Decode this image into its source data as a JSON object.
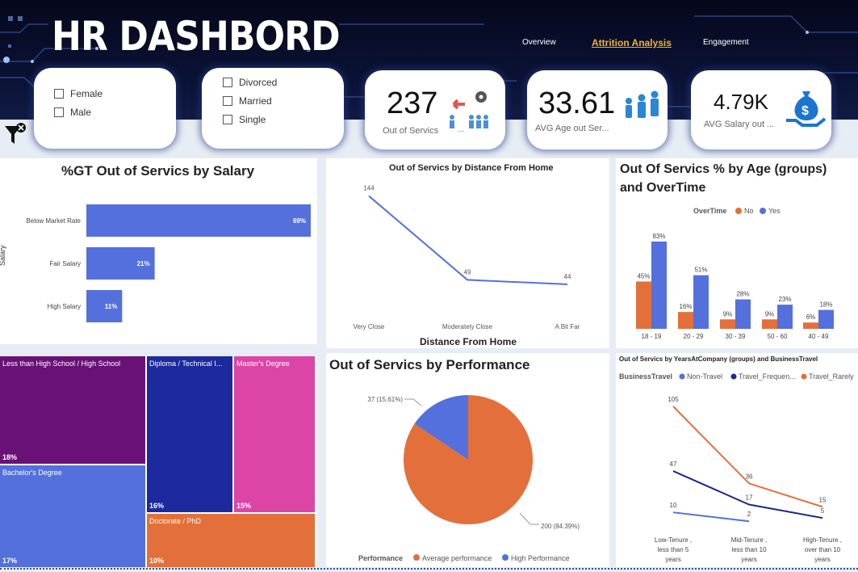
{
  "header": {
    "title": "HR DASHBORD",
    "nav": [
      "Overview",
      "Attrition Analysis",
      "Engagement"
    ],
    "active_nav": "Attrition Analysis"
  },
  "slicers": {
    "gender": [
      "Female",
      "Male"
    ],
    "marital": [
      "Divorced",
      "Married",
      "Single"
    ]
  },
  "kpis": [
    {
      "value": "237",
      "label": "Out of Servics",
      "icon": "people-out-icon"
    },
    {
      "value": "33.61",
      "label": "AVG Age out Ser...",
      "icon": "people-group-icon"
    },
    {
      "value": "4.79K",
      "label": "AVG Salary out ...",
      "icon": "money-bag-icon"
    }
  ],
  "kpi_extra": {
    "ellipsis": "..."
  },
  "colors": {
    "blue": "#5470dc",
    "orange": "#e3703a",
    "navy": "#1c2a86",
    "purple": "#6a1178",
    "magenta": "#dc44a6",
    "header": "#0b1336"
  },
  "salary_chart": {
    "title": "%GT Out of Servics by Salary",
    "ylabel": "Salary"
  },
  "distance_chart": {
    "title": "Out of Servics by Distance From Home",
    "xlabel": "Distance From Home"
  },
  "age_chart": {
    "title_line1": "Out Of Servics % by Age (groups)",
    "title_line2": "and OverTime",
    "legend_title": "OverTime",
    "legend": [
      "No",
      "Yes"
    ]
  },
  "education_treemap": {
    "cells": [
      {
        "label": "Less than High School / High School",
        "pct": "18%"
      },
      {
        "label": "Bachelor's Degree",
        "pct": "17%"
      },
      {
        "label": "Diploma / Technical I...",
        "pct": "16%"
      },
      {
        "label": "Master's Degree",
        "pct": "15%"
      },
      {
        "label": "Doctorate / PhD",
        "pct": "10%"
      }
    ]
  },
  "performance_chart": {
    "title": "Out of Servics by Performance",
    "legend_title": "Performance",
    "legend": [
      "Average performance",
      "High Performance"
    ]
  },
  "tenure_chart": {
    "title": "Out of Servics by YearsAtCompany (groups) and BusinessTravel",
    "legend_title": "BusinessTravel",
    "legend": [
      "Non-Travel",
      "Travel_Frequen...",
      "Travel_Rarely"
    ]
  },
  "chart_data": [
    {
      "id": "salary",
      "type": "bar",
      "orientation": "horizontal",
      "title": "%GT Out of Servics by Salary",
      "ylabel": "Salary",
      "categories": [
        "Below Market Rate",
        "Fair Salary",
        "High Salary"
      ],
      "values": [
        69,
        21,
        11
      ],
      "value_labels": [
        "69%",
        "21%",
        "11%"
      ],
      "xlim": [
        0,
        69
      ]
    },
    {
      "id": "distance",
      "type": "line",
      "title": "Out of Servics by Distance From Home",
      "xlabel": "Distance From Home",
      "categories": [
        "Very Close",
        "Moderately Close",
        "A Bit Far"
      ],
      "values": [
        144,
        49,
        44
      ],
      "ylim": [
        0,
        150
      ]
    },
    {
      "id": "age_overtime",
      "type": "bar",
      "title": "Out Of Servics % by Age (groups) and OverTime",
      "categories": [
        "18 - 19",
        "20 - 29",
        "30 - 39",
        "50 - 60",
        "40 - 49"
      ],
      "series": [
        {
          "name": "No",
          "values": [
            45,
            16,
            9,
            9,
            6
          ],
          "labels": [
            "45%",
            "16%",
            "9%",
            "9%",
            "6%"
          ]
        },
        {
          "name": "Yes",
          "values": [
            83,
            51,
            28,
            23,
            18
          ],
          "labels": [
            "83%",
            "51%",
            "28%",
            "23%",
            "18%"
          ]
        }
      ],
      "ylim": [
        0,
        90
      ]
    },
    {
      "id": "performance",
      "type": "pie",
      "title": "Out of Servics by Performance",
      "categories": [
        "Average performance",
        "High Performance"
      ],
      "values": [
        200,
        37
      ],
      "labels": [
        "200 (84.39%)",
        "37 (15.61%)"
      ]
    },
    {
      "id": "tenure_travel",
      "type": "line",
      "title": "Out of Servics by YearsAtCompany (groups) and BusinessTravel",
      "categories": [
        "Low-Tenure , less than 5 years",
        "Mid-Tenure , less than 10 years",
        "High-Tenure , over than 10 years"
      ],
      "category_lines": [
        [
          "Low-Tenure ,",
          "less than 5",
          "years"
        ],
        [
          "Mid-Tenure ,",
          "less than 10",
          "years"
        ],
        [
          "High-Tenure ,",
          "over than 10",
          "years"
        ]
      ],
      "series": [
        {
          "name": "Non-Travel",
          "values": [
            10,
            2,
            null
          ]
        },
        {
          "name": "Travel_Frequen...",
          "values": [
            47,
            17,
            5
          ]
        },
        {
          "name": "Travel_Rarely",
          "values": [
            105,
            36,
            15
          ]
        }
      ],
      "ylim": [
        0,
        110
      ]
    }
  ]
}
